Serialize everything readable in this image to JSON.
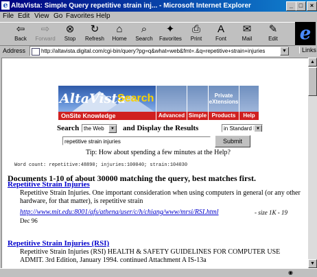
{
  "window": {
    "title": "AltaVista: Simple Query repetitive strain inj... - Microsoft Internet Explorer",
    "min": "_",
    "max": "□",
    "close": "×"
  },
  "menu": [
    "File",
    "Edit",
    "View",
    "Go",
    "Favorites",
    "Help"
  ],
  "toolbar": [
    {
      "label": "Back",
      "icon": "back-arrow-icon",
      "glyph": "⇦",
      "enabled": true
    },
    {
      "label": "Forward",
      "icon": "forward-arrow-icon",
      "glyph": "⇨",
      "enabled": false
    },
    {
      "label": "Stop",
      "icon": "stop-icon",
      "glyph": "⊗",
      "enabled": true
    },
    {
      "label": "Refresh",
      "icon": "refresh-icon",
      "glyph": "↻",
      "enabled": true
    },
    {
      "label": "Home",
      "icon": "home-icon",
      "glyph": "⌂",
      "enabled": true
    },
    {
      "label": "Search",
      "icon": "search-icon",
      "glyph": "⌕",
      "enabled": true
    },
    {
      "label": "Favorites",
      "icon": "favorites-icon",
      "glyph": "✦",
      "enabled": true
    },
    {
      "label": "Print",
      "icon": "print-icon",
      "glyph": "⎙",
      "enabled": true
    },
    {
      "label": "Font",
      "icon": "font-icon",
      "glyph": "A",
      "enabled": true
    },
    {
      "label": "Mail",
      "icon": "mail-icon",
      "glyph": "✉",
      "enabled": true
    },
    {
      "label": "Edit",
      "icon": "edit-icon",
      "glyph": "✎",
      "enabled": true
    }
  ],
  "address": {
    "label": "Address",
    "url": "http://altavista.digital.com/cgi-bin/query?pg=q&what=web&fmt=.&q=repetitive+strain+injuries",
    "links_label": "Links"
  },
  "banner": {
    "logo": "AltaVista",
    "search_word": "Search",
    "onsite": "OnSite Knowledge",
    "tabs": [
      {
        "label": "Advanced",
        "top": ""
      },
      {
        "label": "Simple",
        "top": ""
      },
      {
        "label": "Products",
        "top": "Private eXtensions"
      },
      {
        "label": "Help",
        "top": ""
      }
    ]
  },
  "search": {
    "search_label": "Search",
    "scope_value": "the Web",
    "display_label": "and Display the Results",
    "format_value": "in Standard Form",
    "query": "repetitive strain injuries",
    "submit_label": "Submit",
    "tip": "Tip: How about spending a few minutes at the Help?"
  },
  "results": {
    "word_count": "Word count: repetitive:48890; injuries:100040; strain:104030",
    "summary": "Documents 1-10 of about 30000 matching the query, best matches first.",
    "items": [
      {
        "title": "Repetitive Strain Injuries",
        "description": "Repetitive Strain Injuries. One important consideration when using computers in general (or any other hardware, for that matter), is repetitive strain",
        "url": "http://www.mit.edu:8001/afs/athena/user/c/h/chiang/www/mrsi/RSI.html",
        "meta": "- size 1K - 19",
        "meta2": "Dec 96"
      },
      {
        "title": "Repetitive Strain Injuries (RSI)",
        "description": "Repetitive Strain Injuries (RSI) HEALTH & SAFETY GUIDELINES FOR COMPUTER USE ADMIT. 3rd Edition, January 1994. continued Attachment A IS-13a",
        "url": "",
        "meta": "",
        "meta2": ""
      }
    ]
  },
  "colors": {
    "titlebar": "#000080",
    "link": "#0000cc",
    "brand_red": "#d02020",
    "brand_blue": "#2f5aa8",
    "search_yellow": "#f8d000"
  }
}
